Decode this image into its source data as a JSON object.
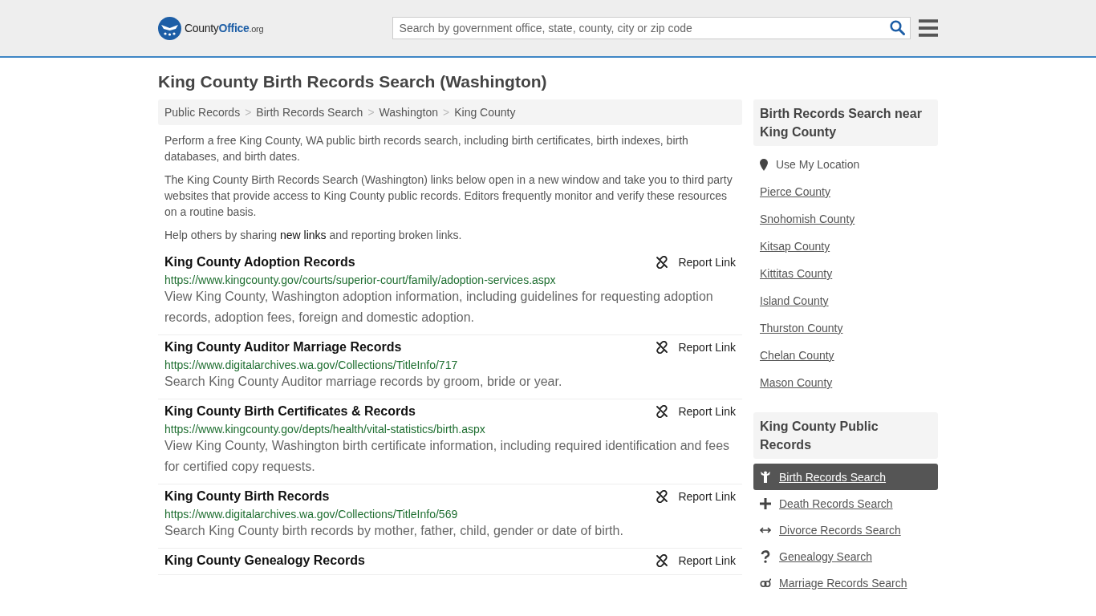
{
  "header": {
    "logo": [
      "County",
      "Office",
      ".org"
    ],
    "search": {
      "placeholder": "Search by government office, state, county, city or zip code"
    }
  },
  "title": "King County Birth Records Search (Washington)",
  "breadcrumbs": [
    "Public Records",
    "Birth Records Search",
    "Washington",
    "King County"
  ],
  "breadcrumb_separator": ">",
  "intro": [
    "Perform a free King County, WA public birth records search, including birth certificates, birth indexes, birth databases, and birth dates.",
    "The King County Birth Records Search (Washington) links below open in a new window and take you to third party websites that provide access to King County public records. Editors frequently monitor and verify these resources on a routine basis."
  ],
  "help": {
    "before": "Help others by sharing",
    "link": "new links",
    "after": "and reporting broken links."
  },
  "records": [
    {
      "title": "King County Adoption Records",
      "url": "https://www.kingcounty.gov/courts/superior-court/family/adoption-services.aspx",
      "description": "View King County, Washington adoption information, including guidelines for requesting adoption records, adoption fees, foreign and domestic adoption.",
      "report": "Report Link"
    },
    {
      "title": "King County Auditor Marriage Records",
      "url": "https://www.digitalarchives.wa.gov/Collections/TitleInfo/717",
      "description": "Search King County Auditor marriage records by groom, bride or year.",
      "report": "Report Link"
    },
    {
      "title": "King County Birth Certificates & Records",
      "url": "https://www.kingcounty.gov/depts/health/vital-statistics/birth.aspx",
      "description": "View King County, Washington birth certificate information, including required identification and fees for certified copy requests.",
      "report": "Report Link"
    },
    {
      "title": "King County Birth Records",
      "url": "https://www.digitalarchives.wa.gov/Collections/TitleInfo/569",
      "description": "Search King County birth records by mother, father, child, gender or date of birth.",
      "report": "Report Link"
    },
    {
      "title": "King County Genealogy Records",
      "report": "Report Link"
    }
  ],
  "nearby": {
    "heading": "Birth Records Search near King County",
    "location": "Use My Location",
    "links": [
      "Pierce County",
      "Snohomish County",
      "Kitsap County",
      "Kittitas County",
      "Island County",
      "Thurston County",
      "Chelan County",
      "Mason County"
    ]
  },
  "public_records": {
    "heading": "King County Public Records",
    "items": [
      {
        "label": "Birth Records Search",
        "kind": "birth",
        "selected": true
      },
      {
        "label": "Death Records Search",
        "kind": "death",
        "selected": false
      },
      {
        "label": "Divorce Records Search",
        "kind": "divorce",
        "selected": false
      },
      {
        "label": "Genealogy Search",
        "kind": "genealogy",
        "selected": false
      },
      {
        "label": "Marriage Records Search",
        "kind": "marriage",
        "selected": false
      }
    ]
  }
}
